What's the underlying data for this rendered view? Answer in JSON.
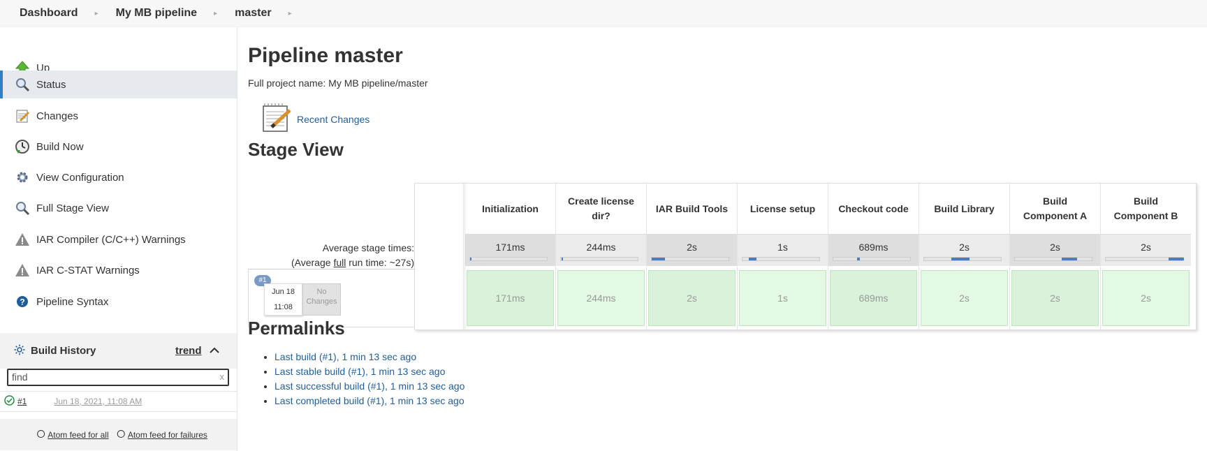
{
  "breadcrumb": {
    "items": [
      "Dashboard",
      "My MB pipeline",
      "master"
    ]
  },
  "sidebar": {
    "tasks": [
      {
        "label": "Up",
        "icon": "up-arrow-icon"
      },
      {
        "label": "Status",
        "icon": "search-icon",
        "active": true
      },
      {
        "label": "Changes",
        "icon": "notepad-icon"
      },
      {
        "label": "Build Now",
        "icon": "clock-build-icon"
      },
      {
        "label": "View Configuration",
        "icon": "gear-icon"
      },
      {
        "label": "Full Stage View",
        "icon": "magnifier-icon"
      },
      {
        "label": "IAR Compiler (C/C++) Warnings",
        "icon": "warning-icon"
      },
      {
        "label": "IAR C-STAT Warnings",
        "icon": "warning-icon"
      },
      {
        "label": "Pipeline Syntax",
        "icon": "help-icon"
      }
    ],
    "build_history": {
      "title": "Build History",
      "trend_label": "trend",
      "search_placeholder": "find",
      "search_value": "find",
      "clear_label": "x",
      "builds": [
        {
          "number": "#1",
          "date": "Jun 18, 2021, 11:08 AM",
          "status": "success"
        }
      ],
      "feed_all": "Atom feed for all",
      "feed_failures": "Atom feed for failures"
    }
  },
  "main": {
    "title": "Pipeline master",
    "full_name": "Full project name: My MB pipeline/master",
    "recent_changes": "Recent Changes",
    "stage_view_title": "Stage View",
    "avg_label_line1": "Average stage times:",
    "avg_label_prefix": "(Average ",
    "avg_label_full": "full",
    "avg_label_suffix": " run time: ~27s)",
    "run": {
      "badge": "#1",
      "date": "Jun 18",
      "time": "11:08",
      "changes_line1": "No",
      "changes_line2": "Changes"
    },
    "stages": [
      {
        "name": "Initialization",
        "avg": "171ms",
        "cell": "171ms",
        "bar_start": 0.0,
        "bar_fraction": 0.01,
        "cell_color": "#d9f2d9"
      },
      {
        "name": "Create license dir?",
        "avg": "244ms",
        "cell": "244ms",
        "bar_start": 0.01,
        "bar_fraction": 0.01,
        "cell_color": "#e3f9e3"
      },
      {
        "name": "IAR Build Tools",
        "avg": "2s",
        "cell": "2s",
        "bar_start": 0.0,
        "bar_fraction": 0.17,
        "cell_color": "#d9f2d9"
      },
      {
        "name": "License setup",
        "avg": "1s",
        "cell": "1s",
        "bar_start": 0.08,
        "bar_fraction": 0.1,
        "cell_color": "#e3f9e3"
      },
      {
        "name": "Checkout code",
        "avg": "689ms",
        "cell": "689ms",
        "bar_start": 0.3,
        "bar_fraction": 0.04,
        "cell_color": "#d9f2d9"
      },
      {
        "name": "Build Library",
        "avg": "2s",
        "cell": "2s",
        "bar_start": 0.35,
        "bar_fraction": 0.23,
        "cell_color": "#e3f9e3"
      },
      {
        "name": "Build Component A",
        "avg": "2s",
        "cell": "2s",
        "bar_start": 0.6,
        "bar_fraction": 0.2,
        "cell_color": "#d9f2d9"
      },
      {
        "name": "Build Component B",
        "avg": "2s",
        "cell": "2s",
        "bar_start": 0.8,
        "bar_fraction": 0.2,
        "cell_color": "#e3f9e3"
      }
    ],
    "permalinks_title": "Permalinks",
    "permalinks": [
      "Last build (#1), 1 min 13 sec ago",
      "Last stable build (#1), 1 min 13 sec ago",
      "Last successful build (#1), 1 min 13 sec ago",
      "Last completed build (#1), 1 min 13 sec ago"
    ]
  },
  "colors": {
    "accent": "#2f80c9",
    "link": "#1f5e9b",
    "success": "#1e8c3a",
    "stage_bar": "#4a7cc4"
  }
}
